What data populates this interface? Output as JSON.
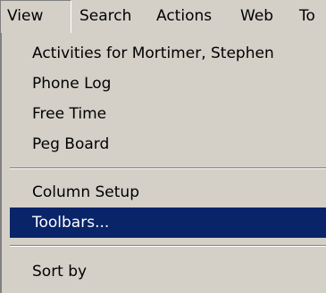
{
  "menubar": {
    "items": [
      {
        "label": "View"
      },
      {
        "label": "Search"
      },
      {
        "label": "Actions"
      },
      {
        "label": "Web"
      },
      {
        "label": "To"
      }
    ],
    "active_item": "View"
  },
  "dropdown": {
    "group1": [
      {
        "label": "Activities for Mortimer, Stephen"
      },
      {
        "label": "Phone Log"
      },
      {
        "label": "Free Time"
      },
      {
        "label": "Peg Board"
      }
    ],
    "group2": [
      {
        "label": "Column Setup"
      },
      {
        "label": "Toolbars..."
      }
    ],
    "group3": [
      {
        "label": "Sort by"
      }
    ],
    "highlighted_item": "Toolbars..."
  },
  "colors": {
    "menu_background": "#d4d0c8",
    "highlight_background": "#0a246a",
    "highlight_text": "#ffffff",
    "text": "#000000"
  }
}
